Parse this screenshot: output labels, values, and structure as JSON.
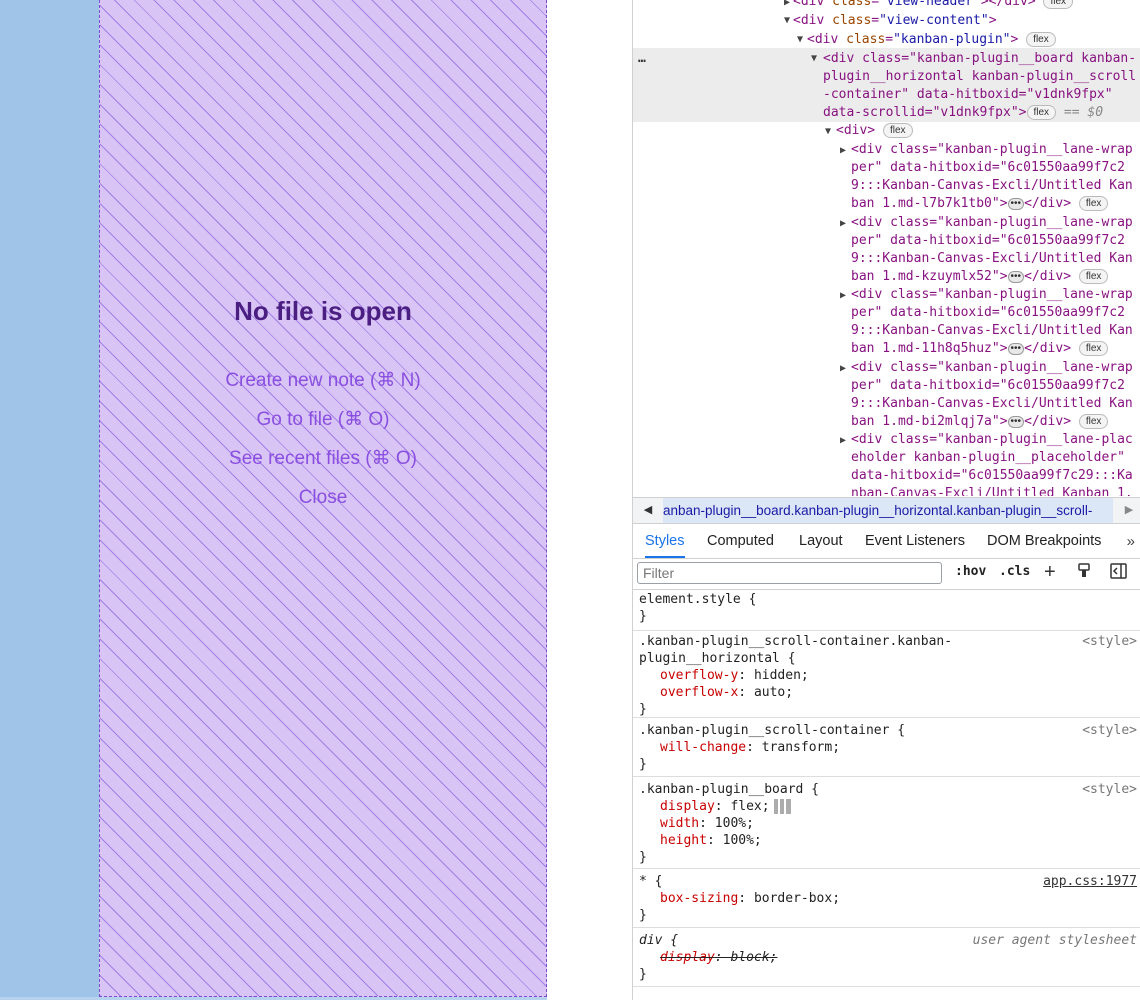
{
  "app": {
    "empty_state": {
      "title": "No file is open",
      "actions": [
        "Create new note (⌘ N)",
        "Go to file (⌘ O)",
        "See recent files (⌘ O)",
        "Close"
      ]
    }
  },
  "devtools": {
    "tree": {
      "line0": {
        "open": "<div ",
        "attr": "class",
        "val": "\"view-header\"",
        "close": "></div>",
        "pill": "flex"
      },
      "line1": {
        "open": "<div ",
        "attr": "class",
        "val": "\"view-content\"",
        "close": ">"
      },
      "line2": {
        "open": "<div ",
        "attr": "class",
        "val": "\"kanban-plugin\"",
        "close": ">",
        "pill": "flex"
      },
      "selected": {
        "l1": "<div class=\"kanban-plugin__board kanban-",
        "l2": "plugin__horizontal kanban-plugin__scroll",
        "l3": "-container\" data-hitboxid=\"v1dnk9fpx\"",
        "l4a": "data-scrollid=\"v1dnk9fpx\">",
        "pill": "flex",
        "eq": "== $0"
      },
      "inner_div": {
        "open": "<div>",
        "pill": "flex"
      },
      "lanes": [
        {
          "l1": "<div class=\"kanban-plugin__lane-wrap",
          "l2": "per\" data-hitboxid=\"6c01550aa99f7c2",
          "l3": "9:::Kanban-Canvas-Excli/Untitled Kan",
          "l4": "ban 1.md-l7b7k1tb0\">",
          "end": "</div>",
          "pill": "flex"
        },
        {
          "l1": "<div class=\"kanban-plugin__lane-wrap",
          "l2": "per\" data-hitboxid=\"6c01550aa99f7c2",
          "l3": "9:::Kanban-Canvas-Excli/Untitled Kan",
          "l4": "ban 1.md-kzuymlx52\">",
          "end": "</div>",
          "pill": "flex"
        },
        {
          "l1": "<div class=\"kanban-plugin__lane-wrap",
          "l2": "per\" data-hitboxid=\"6c01550aa99f7c2",
          "l3": "9:::Kanban-Canvas-Excli/Untitled Kan",
          "l4": "ban 1.md-11h8q5huz\">",
          "end": "</div>",
          "pill": "flex"
        },
        {
          "l1": "<div class=\"kanban-plugin__lane-wrap",
          "l2": "per\" data-hitboxid=\"6c01550aa99f7c2",
          "l3": "9:::Kanban-Canvas-Excli/Untitled Kan",
          "l4": "ban 1.md-bi2mlqj7a\">",
          "end": "</div>",
          "pill": "flex"
        }
      ],
      "placeholder": {
        "l1": "<div class=\"kanban-plugin__lane-plac",
        "l2": "eholder kanban-plugin__placeholder\"",
        "l3": "data-hitboxid=\"6c01550aa99f7c29:::Ka",
        "l4": "nban-Canvas-Excli/Untitled Kanban 1."
      },
      "dots": "…"
    },
    "breadcrumb": "anban-plugin__board.kanban-plugin__horizontal.kanban-plugin__scroll-",
    "tabs": [
      "Styles",
      "Computed",
      "Layout",
      "Event Listeners",
      "DOM Breakpoints"
    ],
    "tab_more": "»",
    "filter": {
      "placeholder": "Filter",
      "hov": ":hov",
      "cls": ".cls"
    },
    "rules": [
      {
        "selector": "element.style {",
        "source": "",
        "props": [],
        "close": "}"
      },
      {
        "selector": ".kanban-plugin__scroll-container.kanban-",
        "selector2": "plugin__horizontal {",
        "source": "<style>",
        "props": [
          {
            "name": "overflow-y",
            "value": "hidden;"
          },
          {
            "name": "overflow-x",
            "value": "auto;"
          }
        ],
        "close": "}"
      },
      {
        "selector": ".kanban-plugin__scroll-container {",
        "source": "<style>",
        "props": [
          {
            "name": "will-change",
            "value": "transform;"
          }
        ],
        "close": "}"
      },
      {
        "selector": ".kanban-plugin__board {",
        "source": "<style>",
        "props": [
          {
            "name": "display",
            "value": "flex;"
          },
          {
            "name": "width",
            "value": "100%;"
          },
          {
            "name": "height",
            "value": "100%;"
          }
        ],
        "close": "}"
      },
      {
        "selector": "* {",
        "source": "app.css:1977",
        "props": [
          {
            "name": "box-sizing",
            "value": "border-box;"
          }
        ],
        "close": "}"
      },
      {
        "selector": "div {",
        "source": "user agent stylesheet",
        "props": [
          {
            "name": "display",
            "value": "block;"
          }
        ],
        "close": "}"
      }
    ]
  }
}
